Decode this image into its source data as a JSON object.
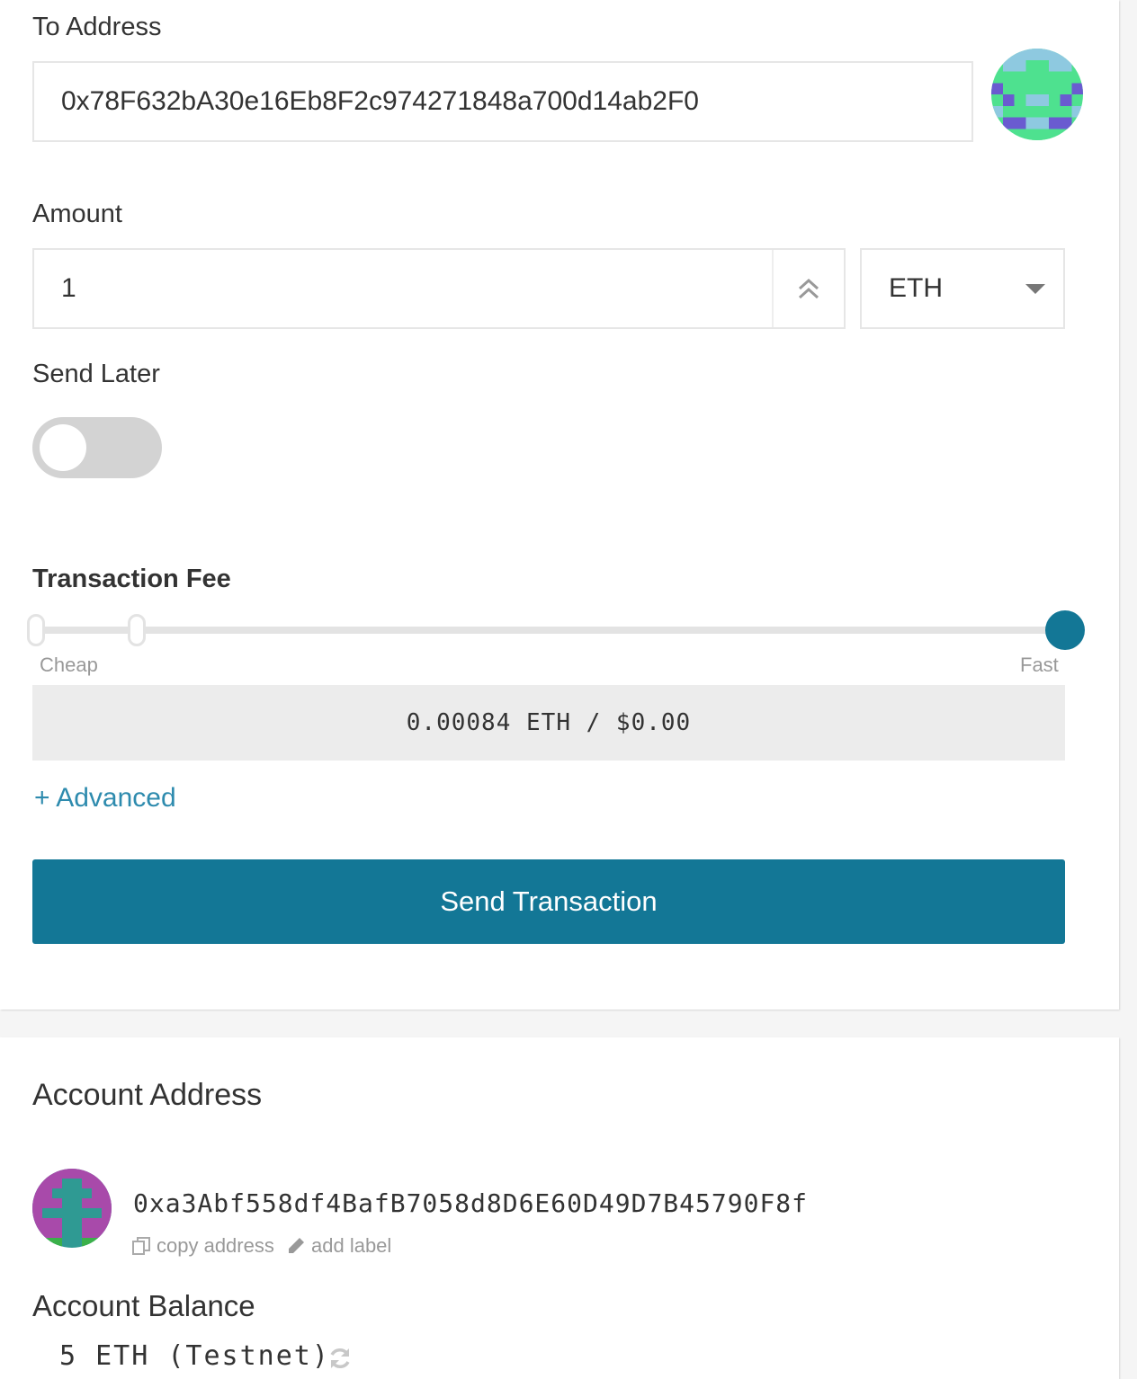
{
  "send_form": {
    "to_address": {
      "label": "To Address",
      "value": "0x78F632bA30e16Eb8F2c974271848a700d14ab2F0"
    },
    "amount": {
      "label": "Amount",
      "value": "1",
      "unit": "ETH"
    },
    "send_later": {
      "label": "Send Later",
      "enabled": false
    },
    "transaction_fee": {
      "label": "Transaction Fee",
      "low_label": "Cheap",
      "high_label": "Fast",
      "level": 1.0,
      "fee_display": "0.00084 ETH / $0.00"
    },
    "advanced_label": "+ Advanced",
    "send_button_label": "Send Transaction"
  },
  "account": {
    "address_heading": "Account Address",
    "address": "0xa3Abf558df4BafB7058d8D6E60D49D7B45790F8f",
    "copy_label": "copy address",
    "label_action": "add label",
    "balance_heading": "Account Balance",
    "balance": "5 ETH (Testnet)"
  },
  "colors": {
    "primary": "#137796",
    "link": "#2e8bae"
  },
  "icons": [
    "double-chevron-up-icon",
    "caret-down-icon",
    "copy-icon",
    "pencil-icon",
    "refresh-icon"
  ]
}
